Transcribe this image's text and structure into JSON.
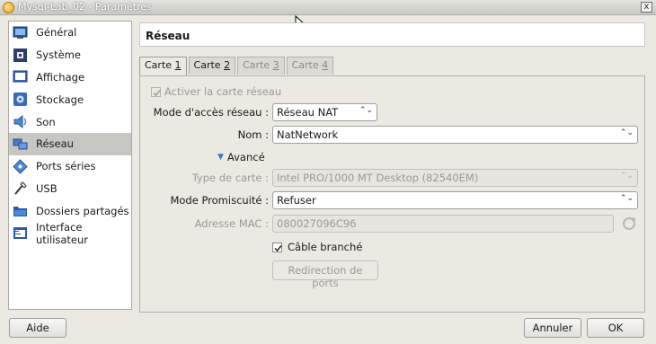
{
  "window": {
    "title": "Mysql-Lab_02 - Paramètres",
    "close": "x"
  },
  "sidebar": {
    "items": [
      {
        "label": "Général",
        "icon": "monitor-icon"
      },
      {
        "label": "Système",
        "icon": "chip-icon"
      },
      {
        "label": "Affichage",
        "icon": "display-icon"
      },
      {
        "label": "Stockage",
        "icon": "storage-icon"
      },
      {
        "label": "Son",
        "icon": "speaker-icon"
      },
      {
        "label": "Réseau",
        "icon": "network-icon"
      },
      {
        "label": "Ports séries",
        "icon": "serial-port-icon"
      },
      {
        "label": "USB",
        "icon": "usb-icon"
      },
      {
        "label": "Dossiers partagés",
        "icon": "folder-icon"
      },
      {
        "label": "Interface utilisateur",
        "icon": "ui-icon"
      }
    ],
    "selected": "Réseau"
  },
  "page": {
    "title": "Réseau"
  },
  "tabs": [
    {
      "prefix": "Carte ",
      "num": "1",
      "state": "active"
    },
    {
      "prefix": "Carte ",
      "num": "2",
      "state": "enabled"
    },
    {
      "prefix": "Carte ",
      "num": "3",
      "state": "disabled"
    },
    {
      "prefix": "Carte ",
      "num": "4",
      "state": "disabled"
    }
  ],
  "form": {
    "enable_label": "Activer la carte réseau",
    "mode_label": "Mode d'accès réseau :",
    "mode_value": "Réseau NAT",
    "name_label": "Nom :",
    "name_value": "NatNetwork",
    "advanced_label": "Avancé",
    "card_type_label": "Type de carte :",
    "card_type_value": "Intel PRO/1000 MT Desktop (82540EM)",
    "promisc_label": "Mode Promiscuité :",
    "promisc_value": "Refuser",
    "mac_label": "Adresse MAC :",
    "mac_value": "080027096C96",
    "cable_label": "Câble branché",
    "port_forward_label": "Redirection de ports"
  },
  "footer": {
    "help": "Aide",
    "cancel": "Annuler",
    "ok": "OK"
  }
}
